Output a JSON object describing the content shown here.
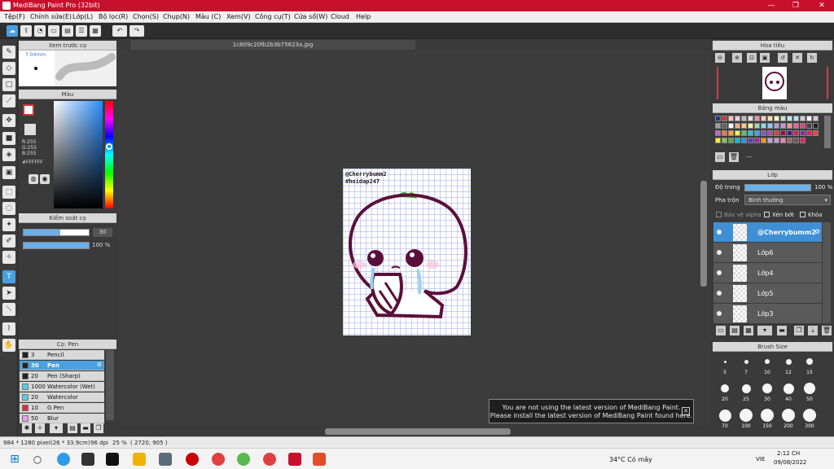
{
  "window": {
    "title": "MediBang Paint Pro (32bit)",
    "minimize": "—",
    "maximize": "❐",
    "close": "✕"
  },
  "menu": [
    "Tệp(F)",
    "Chỉnh sửa(E)",
    "Lớp(L)",
    "Bộ lọc(R)",
    "Chọn(S)",
    "Chụp(N)",
    "Màu (C)",
    "Xem(V)",
    "Công cụ(T)",
    "Cửa sổ(W)",
    "Cloud",
    "Help"
  ],
  "document": {
    "tab_name": "1c809c20fb2b3b75623a.jpg",
    "text_line1": "@Cherrybumm2",
    "text_line2": "#hoidap247"
  },
  "preview_panel": {
    "title": "Xem trước cọ",
    "size_label": "7.04mm"
  },
  "color_panel": {
    "title": "Màu",
    "r": "R:255",
    "g": "G:255",
    "b": "B:255",
    "hex": "#FFFFFF"
  },
  "brush_control": {
    "title": "Kiểm soát cọ",
    "size_value": "30",
    "opacity_value": "100 %"
  },
  "brush_list": {
    "title": "Cọ: Pen",
    "items": [
      {
        "size": "3",
        "name": "Pencil",
        "color": "#222222"
      },
      {
        "size": "30",
        "name": "Pen",
        "color": "#222222",
        "selected": true
      },
      {
        "size": "20",
        "name": "Pen (Sharp)",
        "color": "#222222"
      },
      {
        "size": "1000",
        "name": "Watercolor (Wet)",
        "color": "#55ccee"
      },
      {
        "size": "20",
        "name": "Watercolor",
        "color": "#55ccee"
      },
      {
        "size": "10",
        "name": "G Pen",
        "color": "#e03030"
      },
      {
        "size": "50",
        "name": "Blur",
        "color": "#ee99ee"
      }
    ]
  },
  "navigator": {
    "title": "Hoa tiêu"
  },
  "palette": {
    "title": "Bảng màu",
    "colors": [
      "#1f3c88",
      "#d32f2f",
      "#f8bbd0",
      "#ffcdd2",
      "#bdbdbd",
      "#e0e0e0",
      "#f48fb1",
      "#ffccbc",
      "#ffe0b2",
      "#fff9c4",
      "#c8e6c9",
      "#b2ebf2",
      "#bbdefb",
      "#d1c4e9",
      "#f5f5f5",
      "#e1bee7",
      "#9e9e9e",
      "#616161",
      "#ffffff",
      "#ffab91",
      "#ffcc80",
      "#fff59d",
      "#a5d6a7",
      "#80deea",
      "#90caf9",
      "#b39ddb",
      "#ce93d8",
      "#ef9a9a",
      "#f06292",
      "#ec407a",
      "#424242",
      "#212121",
      "#ba68c8",
      "#ff7043",
      "#ffa726",
      "#ffee58",
      "#66bb6a",
      "#26c6da",
      "#42a5f5",
      "#7e57c2",
      "#ab47bc",
      "#e53935",
      "#880e4f",
      "#4a148c",
      "#d81b60",
      "#8e24aa",
      "#e91e63",
      "#f44336",
      "#ffeb3b",
      "#8bc34a",
      "#4caf50",
      "#00bcd4",
      "#2196f3",
      "#673ab7",
      "#9c27b0",
      "#ff9800",
      "#c5a3d9",
      "#ce93d8",
      "#ff80ab",
      "#8d6e63",
      "#795548",
      "#e91e63"
    ],
    "footer": "---"
  },
  "layers": {
    "title": "Lớp",
    "opacity_label": "Độ trong",
    "opacity_value": "100 %",
    "blend_label": "Pha trộn",
    "blend_value": "Bình thường",
    "protect_alpha": "Bảo vệ alpha",
    "clipping": "Xén bớt",
    "lock": "Khóa",
    "items": [
      {
        "name": "@Cherrybumm2",
        "selected": true
      },
      {
        "name": "Lớp6"
      },
      {
        "name": "Lớp4"
      },
      {
        "name": "Lớp5"
      },
      {
        "name": "Lớp3"
      }
    ]
  },
  "brush_size_panel": {
    "title": "Brush Size",
    "row1": [
      "5",
      "7",
      "10",
      "12",
      "15"
    ],
    "row2": [
      "20",
      "25",
      "30",
      "40",
      "50"
    ],
    "row3": [
      "70",
      "100",
      "150",
      "200",
      "300"
    ]
  },
  "notification": {
    "line1": "You are not using the latest version of MediBang Paint.",
    "line2": "Please install the latest version of MediBang Paint found here.",
    "close": "✕"
  },
  "status": {
    "dims": "984 * 1280 pixel",
    "cm": "(26 * 33.9cm)",
    "dpi": "96 dpi",
    "zoom": "25 %",
    "coords": "( 2720, 905 )"
  },
  "taskbar": {
    "weather": "34°C Có mây",
    "lang": "VIE",
    "time": "2:12 CH",
    "date": "09/08/2022"
  }
}
